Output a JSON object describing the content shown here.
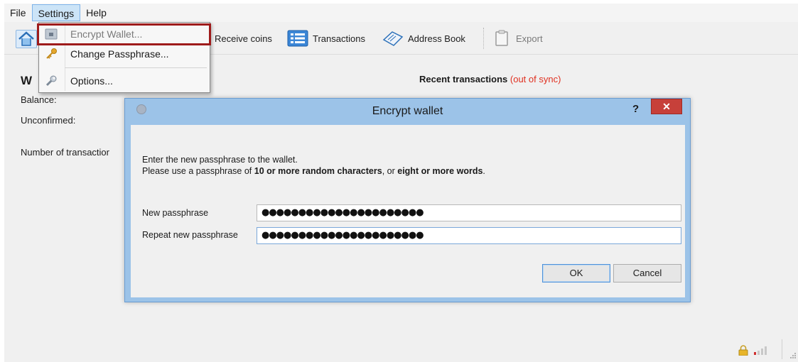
{
  "menubar": {
    "items": [
      "File",
      "Settings",
      "Help"
    ]
  },
  "toolbar": {
    "receive_label": "Receive coins",
    "transactions_label": "Transactions",
    "address_book_label": "Address Book",
    "export_label": "Export"
  },
  "settings_menu": {
    "items": [
      {
        "label": "Encrypt Wallet...",
        "icon": "lock-icon",
        "enabled": false
      },
      {
        "label": "Change Passphrase...",
        "icon": "key-icon",
        "enabled": true
      },
      {
        "label": "Options...",
        "icon": "wrench-icon",
        "enabled": true
      }
    ]
  },
  "overview": {
    "title_initial": "W",
    "balance_label": "Balance:",
    "unconfirmed_label": "Unconfirmed:",
    "num_transactions_label": "Number of transactior",
    "recent_label": "Recent transactions",
    "out_of_sync": "(out of sync)"
  },
  "dialog": {
    "title": "Encrypt wallet",
    "help_label": "?",
    "close_label": "✕",
    "line1": "Enter the new passphrase to the wallet.",
    "line2_part1": "Please use a passphrase of ",
    "line2_bold1": "10 or more random characters",
    "line2_part2": ", or ",
    "line2_bold2": "eight or more words",
    "line2_part3": ".",
    "new_pass_label": "New passphrase",
    "new_pass_value": "●●●●●●●●●●●●●●●●●●●●●●",
    "repeat_pass_label": "Repeat new passphrase",
    "repeat_pass_value": "●●●●●●●●●●●●●●●●●●●●●●",
    "ok_label": "OK",
    "cancel_label": "Cancel"
  },
  "colors": {
    "highlight_frame": "#9e1b1b",
    "out_of_sync": "#e03020",
    "dialog_chrome": "#9cc3e8",
    "close_button": "#c7403a"
  }
}
